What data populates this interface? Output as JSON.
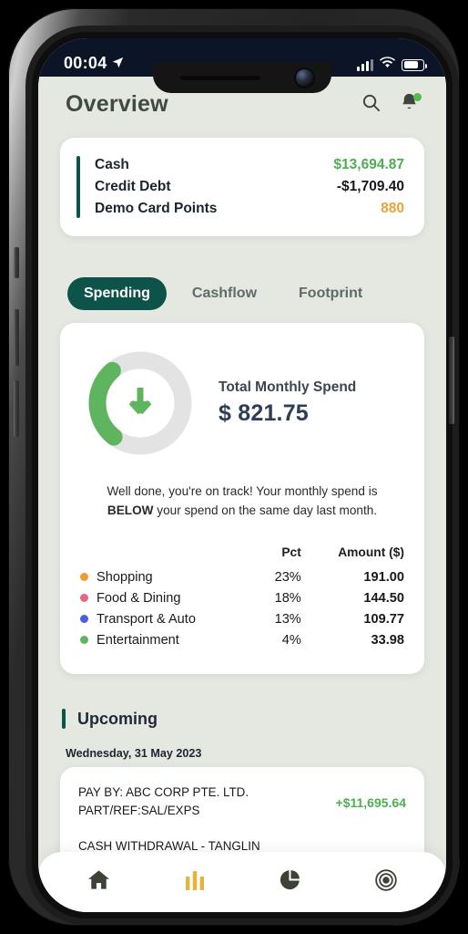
{
  "status_bar": {
    "time": "00:04",
    "location_icon": "location-arrow-icon",
    "signal_icon": "cellular-signal-icon",
    "wifi_icon": "wifi-icon",
    "battery_icon": "battery-icon"
  },
  "header": {
    "title": "Overview",
    "search_icon": "search-icon",
    "notification_icon": "bell-icon",
    "has_notification_badge": true
  },
  "summary": {
    "accent_color": "#0e5349",
    "rows": [
      {
        "label": "Cash",
        "value": "$13,694.87",
        "color": "#4caf50"
      },
      {
        "label": "Credit Debt",
        "value": "-$1,709.40",
        "color": "#16181d"
      },
      {
        "label": "Demo Card Points",
        "value": "880",
        "color": "#e8a33d"
      }
    ]
  },
  "tabs": {
    "items": [
      {
        "label": "Spending",
        "active": true
      },
      {
        "label": "Cashflow",
        "active": false
      },
      {
        "label": "Footprint",
        "active": false
      }
    ],
    "active_bg": "#0e5349"
  },
  "spending": {
    "total_label": "Total Monthly Spend",
    "total_value": "$ 821.75",
    "arrow_icon": "arrow-down-icon",
    "donut_color": "#5fb55f",
    "donut_track_color": "#e3e3e3",
    "message_prefix": "Well done, you're on track! Your monthly spend is ",
    "message_bold": "BELOW",
    "message_suffix": " your spend on the same day last month.",
    "table": {
      "headers": {
        "name": "",
        "pct": "Pct",
        "amount": "Amount ($)"
      },
      "rows": [
        {
          "name": "Shopping",
          "pct": "23%",
          "amount": "191.00",
          "color": "#ed9b33"
        },
        {
          "name": "Food & Dining",
          "pct": "18%",
          "amount": "144.50",
          "color": "#e4697e"
        },
        {
          "name": "Transport & Auto",
          "pct": "13%",
          "amount": "109.77",
          "color": "#4a5fdb"
        },
        {
          "name": "Entertainment",
          "pct": "4%",
          "amount": "33.98",
          "color": "#5fb55f"
        }
      ]
    }
  },
  "chart_data": {
    "type": "pie",
    "title": "Total Monthly Spend",
    "categories": [
      "Shopping",
      "Food & Dining",
      "Transport & Auto",
      "Entertainment"
    ],
    "values": [
      191.0,
      144.5,
      109.77,
      33.98
    ],
    "percentages": [
      23,
      18,
      13,
      4
    ],
    "colors": [
      "#ed9b33",
      "#e4697e",
      "#4a5fdb",
      "#5fb55f"
    ],
    "total": 821.75,
    "unit": "$",
    "donut_progress_pct": 28,
    "donut_color": "#5fb55f",
    "legend_position": "below",
    "grid": false
  },
  "upcoming": {
    "title": "Upcoming",
    "date": "Wednesday, 31 May 2023",
    "transactions": [
      {
        "description_line1": "PAY BY: ABC CORP PTE. LTD.",
        "description_line2": "PART/REF:SAL/EXPS",
        "amount": "+$11,695.64",
        "amount_color": "#4caf50"
      },
      {
        "description_line1": "CASH WITHDRAWAL - TANGLIN",
        "description_line2": "",
        "amount": "",
        "amount_color": ""
      }
    ]
  },
  "bottom_nav": {
    "items": [
      {
        "icon": "home-icon",
        "active": false
      },
      {
        "icon": "bar-chart-icon",
        "active": true
      },
      {
        "icon": "pie-chart-icon",
        "active": false
      },
      {
        "icon": "target-icon",
        "active": false
      }
    ],
    "active_color": "#e8b33d",
    "inactive_color": "#3b4236"
  }
}
